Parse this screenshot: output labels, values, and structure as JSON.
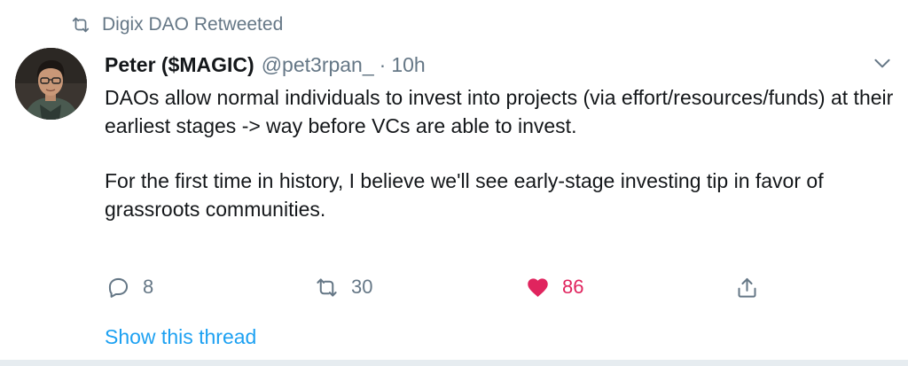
{
  "retweet": {
    "icon": "retweet-icon",
    "text": "Digix DAO Retweeted"
  },
  "tweet": {
    "author_name": "Peter ($MAGIC)",
    "author_handle": "@pet3rpan_",
    "separator": "·",
    "time": "10h",
    "paragraphs": [
      "DAOs allow normal individuals to invest into projects (via effort/resources/funds) at their earliest stages -> way before VCs are able to invest.",
      "For the first time in history, I believe we'll see early-stage investing tip in favor of grassroots communities."
    ]
  },
  "actions": {
    "reply": {
      "icon": "reply-icon",
      "count": "8"
    },
    "retweet": {
      "icon": "retweet-icon",
      "count": "30"
    },
    "like": {
      "icon": "heart-icon",
      "count": "86",
      "liked": true
    },
    "share": {
      "icon": "share-icon"
    }
  },
  "show_thread": "Show this thread",
  "colors": {
    "secondary_text": "#657786",
    "link": "#1da1f2",
    "like": "#e0245e",
    "divider": "#e6ecf0"
  }
}
